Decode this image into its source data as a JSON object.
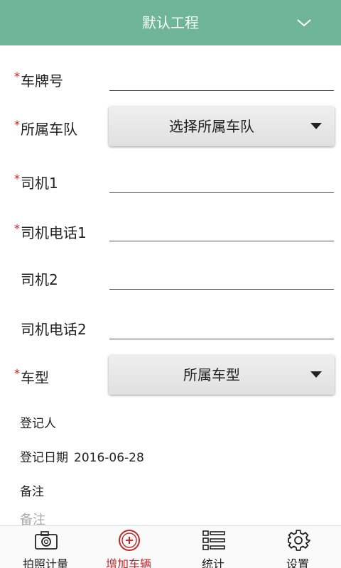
{
  "header": {
    "title": "默认工程"
  },
  "form": {
    "plate": {
      "required_mark": "*",
      "label": "车牌号",
      "value": ""
    },
    "fleet": {
      "required_mark": "*",
      "label": "所属车队",
      "selected": "选择所属车队"
    },
    "driver1": {
      "required_mark": "*",
      "label": "司机1",
      "value": ""
    },
    "driver1_phone": {
      "required_mark": "*",
      "label": "司机电话1",
      "value": ""
    },
    "driver2": {
      "label": "司机2",
      "value": ""
    },
    "driver2_phone": {
      "label": "司机电话2",
      "value": ""
    },
    "vehicle_type": {
      "required_mark": "*",
      "label": "车型",
      "selected": "所属车型"
    },
    "registrant": {
      "label": "登记人"
    },
    "register_date": {
      "label": "登记日期",
      "value": "2016-06-28"
    },
    "remark": {
      "label": "备注",
      "placeholder": "备注"
    }
  },
  "tabbar": {
    "items": [
      {
        "label": "拍照计量",
        "icon": "camera-icon"
      },
      {
        "label": "增加车辆",
        "icon": "add-circle-icon",
        "active": true
      },
      {
        "label": "统计",
        "icon": "list-icon"
      },
      {
        "label": "设置",
        "icon": "gear-icon"
      }
    ]
  },
  "colors": {
    "header_bg": "#6fb59a",
    "accent_red": "#c0282b"
  }
}
